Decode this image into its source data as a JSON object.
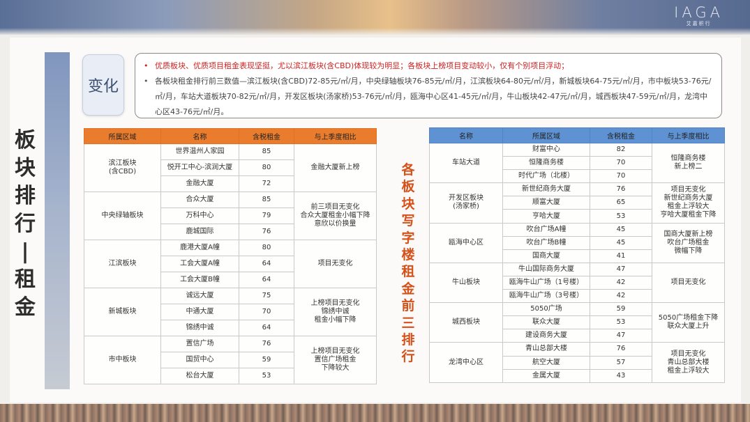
{
  "logo": {
    "mark": "IAGA",
    "sub": "艾嘉积行"
  },
  "side_title": [
    "板",
    "块",
    "排",
    "行",
    "|",
    "租",
    "金"
  ],
  "change": {
    "tag": "变化",
    "highlight": "优质板块、优质项目租金表现坚挺，尤以滨江板块(含CBD)体现较为明显；各板块上榜项目变动较小，仅有个别项目浮动；",
    "detail": "各板块租金排行前三数值—滨江板块(含CBD)72-85元/㎡/月，中央绿轴板块76-85元/㎡/月，江滨板块64-80元/㎡/月，新城板块64-75元/㎡/月，市中板块53-76元/㎡/月，车站大道板块70-82元/㎡/月，开发区板块(汤家桥)53-76元/㎡/月，瓯海中心区41-45元/㎡/月，牛山板块42-47元/㎡/月，城西板块47-59元/㎡/月，龙湾中心区43-76元/㎡/月。"
  },
  "mid_title": [
    "各",
    "板",
    "块",
    "写",
    "字",
    "楼",
    "租",
    "金",
    "前",
    "三",
    "排",
    "行"
  ],
  "left_table": {
    "headers": [
      "所属区域",
      "名称",
      "含税租金",
      "与上季度相比"
    ],
    "groups": [
      {
        "region": "滨江板块\n(含CBD)",
        "note": "金融大厦新上榜",
        "rows": [
          {
            "name": "世界温州人家园",
            "rent": "85"
          },
          {
            "name": "悦开工中心-滨润大厦",
            "rent": "80"
          },
          {
            "name": "金融大厦",
            "rent": "72"
          }
        ]
      },
      {
        "region": "中央绿轴板块",
        "note": "前三项目无变化\n合众大厦租金小幅下降\n意欣以价换量",
        "rows": [
          {
            "name": "合众大厦",
            "rent": "85"
          },
          {
            "name": "万科中心",
            "rent": "79"
          },
          {
            "name": "鹿城国际",
            "rent": "76"
          }
        ]
      },
      {
        "region": "江滨板块",
        "note": "项目无变化",
        "rows": [
          {
            "name": "鹿港大厦A幢",
            "rent": "80"
          },
          {
            "name": "工会大厦A幢",
            "rent": "64"
          },
          {
            "name": "工会大厦B幢",
            "rent": "64"
          }
        ]
      },
      {
        "region": "新城板块",
        "note": "上榜项目无变化\n锦绣中诚\n租金小幅下降",
        "rows": [
          {
            "name": "诚远大厦",
            "rent": "75"
          },
          {
            "name": "中通大厦",
            "rent": "70"
          },
          {
            "name": "锦绣中诚",
            "rent": "64"
          }
        ]
      },
      {
        "region": "市中板块",
        "note": "上榜项目无变化\n置信广场租金\n下降较大",
        "rows": [
          {
            "name": "置信广场",
            "rent": "76"
          },
          {
            "name": "国贸中心",
            "rent": "59"
          },
          {
            "name": "松台大厦",
            "rent": "53"
          }
        ]
      }
    ]
  },
  "right_table": {
    "headers": [
      "名称",
      "所属区域",
      "含税租金",
      "与上季度相比"
    ],
    "groups": [
      {
        "region": "车站大道",
        "note": "恒隆商务楼\n新上榜二",
        "rows": [
          {
            "name": "财富中心",
            "rent": "82"
          },
          {
            "name": "恒隆商务楼",
            "rent": "70"
          },
          {
            "name": "时代广场（北楼）",
            "rent": "70"
          }
        ]
      },
      {
        "region": "开发区板块\n(汤家桥)",
        "note": "项目无变化\n新世纪商务大厦\n租金上浮较大\n亨哈大厦租金下降",
        "rows": [
          {
            "name": "新世纪商务大厦",
            "rent": "76"
          },
          {
            "name": "顺富大厦",
            "rent": "65"
          },
          {
            "name": "亨哈大厦",
            "rent": "53"
          }
        ]
      },
      {
        "region": "瓯海中心区",
        "note": "国商大厦新上榜\n吹台广场租金\n微幅下降",
        "rows": [
          {
            "name": "吹台广场A幢",
            "rent": "45"
          },
          {
            "name": "吹台广场B幢",
            "rent": "45"
          },
          {
            "name": "国商大厦",
            "rent": "41"
          }
        ]
      },
      {
        "region": "牛山板块",
        "note": "项目无变化",
        "rows": [
          {
            "name": "牛山国际商务大厦",
            "rent": "47"
          },
          {
            "name": "瓯海牛山广场（1号楼）",
            "rent": "42"
          },
          {
            "name": "瓯海牛山广场（3号楼）",
            "rent": "42"
          }
        ]
      },
      {
        "region": "城西板块",
        "note": "5050广场租金下降\n联众大厦上升",
        "rows": [
          {
            "name": "5050广场",
            "rent": "59"
          },
          {
            "name": "联众大厦",
            "rent": "53"
          },
          {
            "name": "建设商务大厦",
            "rent": "47"
          }
        ]
      },
      {
        "region": "龙湾中心区",
        "note": "项目无变化\n青山总部大楼\n租金上浮较大",
        "rows": [
          {
            "name": "青山总部大楼",
            "rent": "76"
          },
          {
            "name": "航空大厦",
            "rent": "57"
          },
          {
            "name": "金属大厦",
            "rent": "43"
          }
        ]
      }
    ]
  }
}
